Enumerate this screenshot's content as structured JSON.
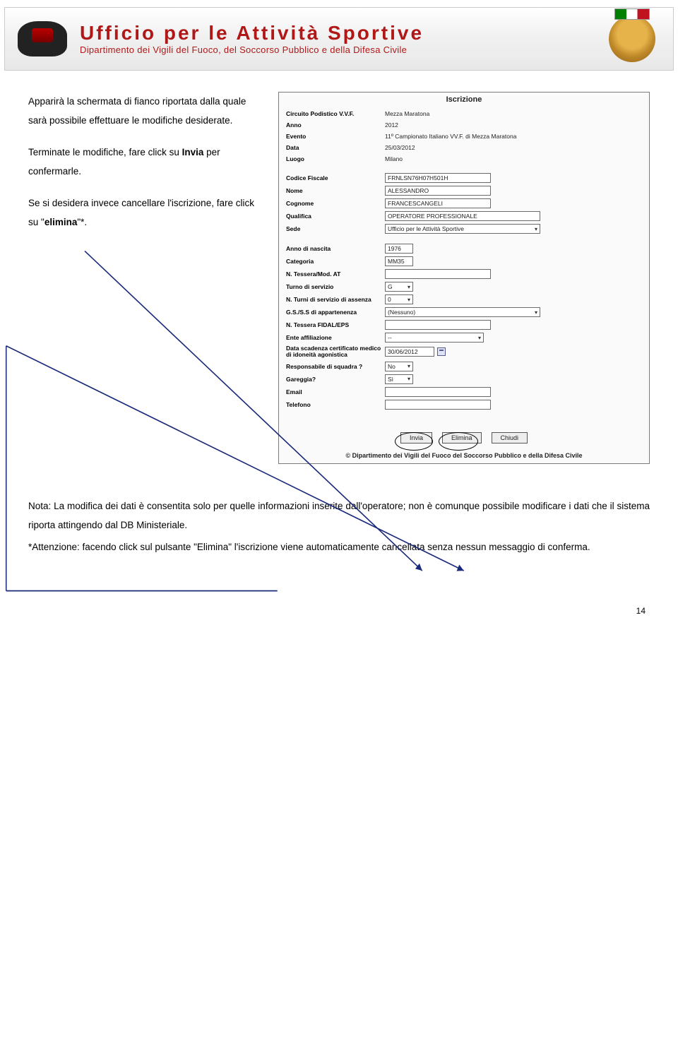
{
  "banner": {
    "title": "Ufficio per le Attività Sportive",
    "subtitle": "Dipartimento dei Vigili del Fuoco, del Soccorso Pubblico e della Difesa Civile"
  },
  "left": {
    "p1a": "Apparirà la schermata di fianco riportata dalla quale sarà possibile effettuare le modifiche desiderate.",
    "p2a": "Terminate le modifiche, fare click su ",
    "p2b": "Invia",
    "p2c": " per confermarle.",
    "p3a": "Se si desidera invece cancellare l'iscrizione, fare click su \"",
    "p3b": "elimina",
    "p3c": "\"*."
  },
  "form": {
    "title": "Iscrizione",
    "rows": {
      "circuito_label": "Circuito Podistico V.V.F.",
      "circuito_val": "Mezza Maratona",
      "anno_label": "Anno",
      "anno_val": "2012",
      "evento_label": "Evento",
      "evento_val": "11º Campionato Italiano VV.F. di Mezza Maratona",
      "data_label": "Data",
      "data_val": "25/03/2012",
      "luogo_label": "Luogo",
      "luogo_val": "Milano",
      "cf_label": "Codice Fiscale",
      "cf_val": "FRNLSN76H07H501H",
      "nome_label": "Nome",
      "nome_val": "ALESSANDRO",
      "cognome_label": "Cognome",
      "cognome_val": "FRANCESCANGELI",
      "qualifica_label": "Qualifica",
      "qualifica_val": "OPERATORE PROFESSIONALE",
      "sede_label": "Sede",
      "sede_val": "Ufficio per le Attività Sportive",
      "anno_nascita_label": "Anno di nascita",
      "anno_nascita_val": "1976",
      "categoria_label": "Categoria",
      "categoria_val": "MM35",
      "tessera_at_label": "N. Tessera/Mod. AT",
      "tessera_at_val": "",
      "turno_label": "Turno di servizio",
      "turno_val": "G",
      "assenza_label": "N. Turni di servizio di assenza",
      "assenza_val": "0",
      "gs_label": "G.S./S.S di appartenenza",
      "gs_val": "(Nessuno)",
      "fidal_label": "N. Tessera FIDAL/EPS",
      "fidal_val": "",
      "ente_label": "Ente affiliazione",
      "ente_val": "--",
      "cert_label": "Data scadenza certificato medico di idoneità agonistica",
      "cert_val": "30/06/2012",
      "resp_label": "Responsabile di squadra ?",
      "resp_val": "No",
      "gareggia_label": "Gareggia?",
      "gareggia_val": "Sì",
      "email_label": "Email",
      "email_val": "",
      "tel_label": "Telefono",
      "tel_val": ""
    },
    "buttons": {
      "invia": "Invia",
      "elimina": "Elimina",
      "chiudi": "Chiudi"
    },
    "copyright": "© Dipartimento dei Vigili del Fuoco del Soccorso Pubblico e della Difesa Civile"
  },
  "bottom": {
    "nota": "Nota: La modifica dei dati è consentita solo per quelle informazioni inserite dall'operatore; non è comunque possibile modificare i dati che il sistema riporta attingendo dal DB Ministeriale.",
    "att": "*Attenzione: facendo click sul pulsante \"Elimina\" l'iscrizione viene automaticamente cancellata senza nessun messaggio di conferma."
  },
  "page_number": "14"
}
